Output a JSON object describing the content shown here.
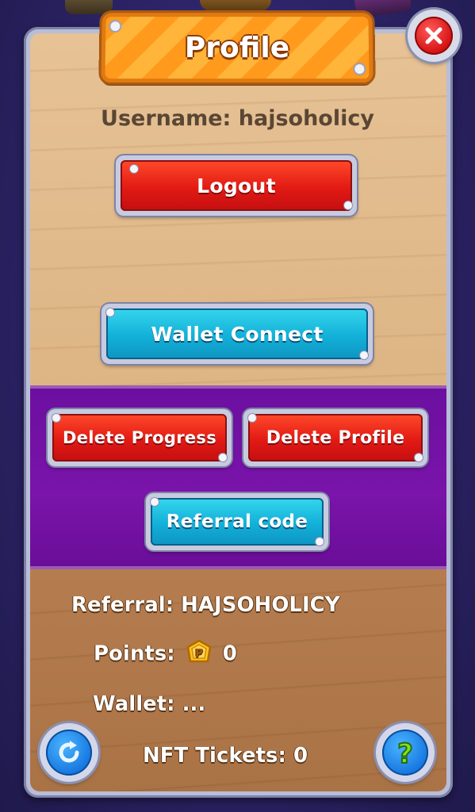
{
  "dialog": {
    "title": "Profile",
    "close_icon": "close-x-icon"
  },
  "profile": {
    "username_label": "Username:",
    "username_value": "hajsoholicy"
  },
  "buttons": {
    "logout": "Logout",
    "wallet_connect": "Wallet Connect",
    "delete_progress": "Delete Progress",
    "delete_profile": "Delete Profile",
    "referral_code": "Referral code"
  },
  "stats": {
    "referral_label": "Referral:",
    "referral_value": "HAJSOHOLICY",
    "points_label": "Points:",
    "points_icon": "points-coin-icon",
    "points_value": "0",
    "wallet_label": "Wallet:",
    "wallet_value": "...",
    "nft_label": "NFT Tickets:",
    "nft_value": "0"
  },
  "corner_buttons": {
    "refresh_icon": "refresh-icon",
    "help_icon": "help-question-icon"
  },
  "colors": {
    "red_button": "#e21a14",
    "cyan_button": "#12b0d8",
    "purple_band": "#7a14aa",
    "title_orange": "#ff9a1c"
  }
}
